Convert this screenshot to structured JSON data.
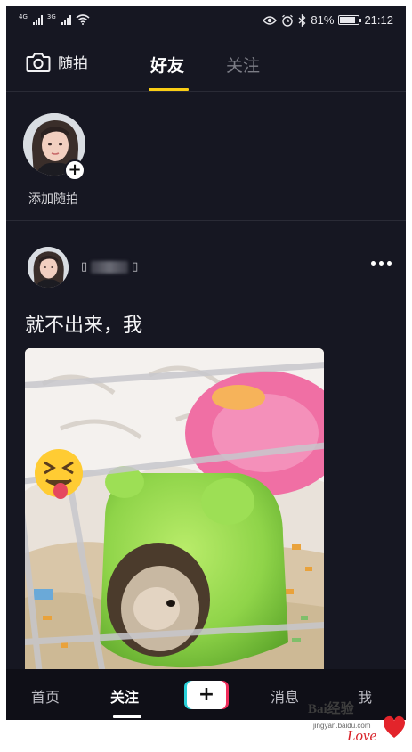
{
  "status_bar": {
    "network_1": "4G",
    "network_2": "3G",
    "battery_text": "81%",
    "battery_level": 0.81,
    "time": "21:12"
  },
  "top_bar": {
    "shoot_label": "随拍",
    "tabs": [
      {
        "label": "好友",
        "active": true
      },
      {
        "label": "关注",
        "active": false
      }
    ],
    "accent_color": "#face15"
  },
  "story": {
    "add_label": "添加随拍",
    "plus": "+"
  },
  "post": {
    "user_prefix": "▯",
    "user_suffix": "▯",
    "caption": "就不出来，我"
  },
  "bottom_nav": {
    "items": [
      {
        "label": "首页"
      },
      {
        "label": "关注",
        "active": true
      },
      {
        "label": "消息"
      },
      {
        "label": "我"
      }
    ],
    "create_symbol": "+"
  },
  "watermark": {
    "brand": "Bai经验",
    "url": "jingyan.baidu.com",
    "love": "Love"
  }
}
